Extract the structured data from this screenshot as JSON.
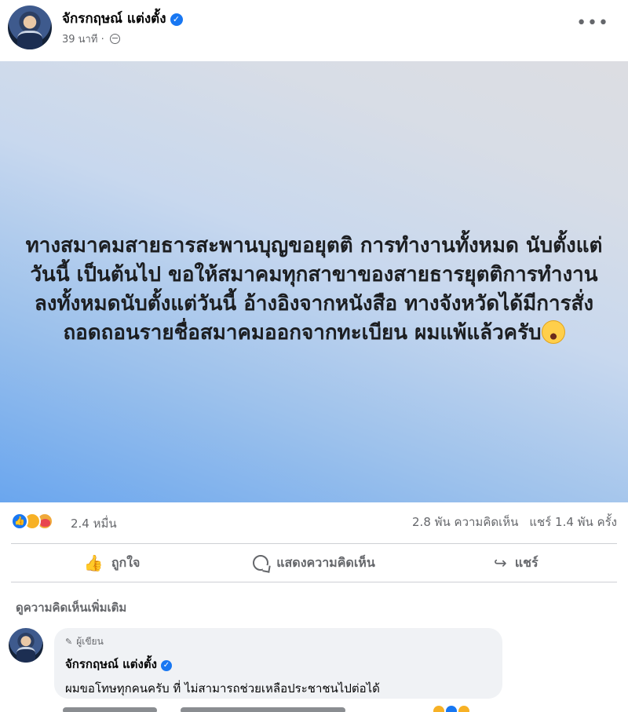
{
  "post": {
    "author_name": "จักรกฤษณ์ แต่งตั้ง",
    "verified_mark": "✓",
    "timestamp": "39 นาที",
    "separator": "·",
    "more_menu": "•••",
    "icons": {
      "avatar": "avatar",
      "verified": "verified-badge-icon",
      "privacy": "globe-icon",
      "more": "more-options-icon"
    },
    "image_text": "ทางสมาคมสายธารสะพานบุญขอยุตติ การทำงานทั้งหมด นับตั้งแต่วันนี้ เป็นต้นไป ขอให้สมาคมทุกสาขาของสายธารยุตติการทำงานลงทั้งหมดนับตั้งแต่วันนี้ อ้างอิงจากหนังสือ ￼ทางจังหวัดได้มีการสั่งถอดถอนรายชื่อสมาคมออกจากทะเบียน ผมแพ้แล้วครับ",
    "image_gradient": [
      "#6aa6ee",
      "#9cc1ec",
      "#c8d8ee",
      "#dcdde2"
    ]
  },
  "stats": {
    "reaction_count": "2.4 หมื่น",
    "comments": "2.8 พัน ความคิดเห็น",
    "shares": "แชร์ 1.4 พัน ครั้ง",
    "reaction_types": [
      "like",
      "sad",
      "care"
    ]
  },
  "actions": {
    "like": "ถูกใจ",
    "comment": "แสดงความคิดเห็น",
    "share": "แชร์",
    "like_icon": "👍",
    "share_icon": "↪"
  },
  "comments_section": {
    "more_comments": "ดูความคิดเห็นเพิ่มเติม",
    "top_comment": {
      "badge": "ผู้เขียน",
      "badge_icon": "✎",
      "author": "จักรกฤษณ์ แต่งตั้ง",
      "text": "ผมขอโทษทุกคนครับ ที่ ไม่สามารถช่วยเหลือประชาชนไปต่อได้ ￼"
    }
  },
  "colors": {
    "accent": "#1877f2",
    "secondary_text": "#65676b",
    "bubble_bg": "#f0f2f5",
    "divider": "#ced0d4"
  }
}
